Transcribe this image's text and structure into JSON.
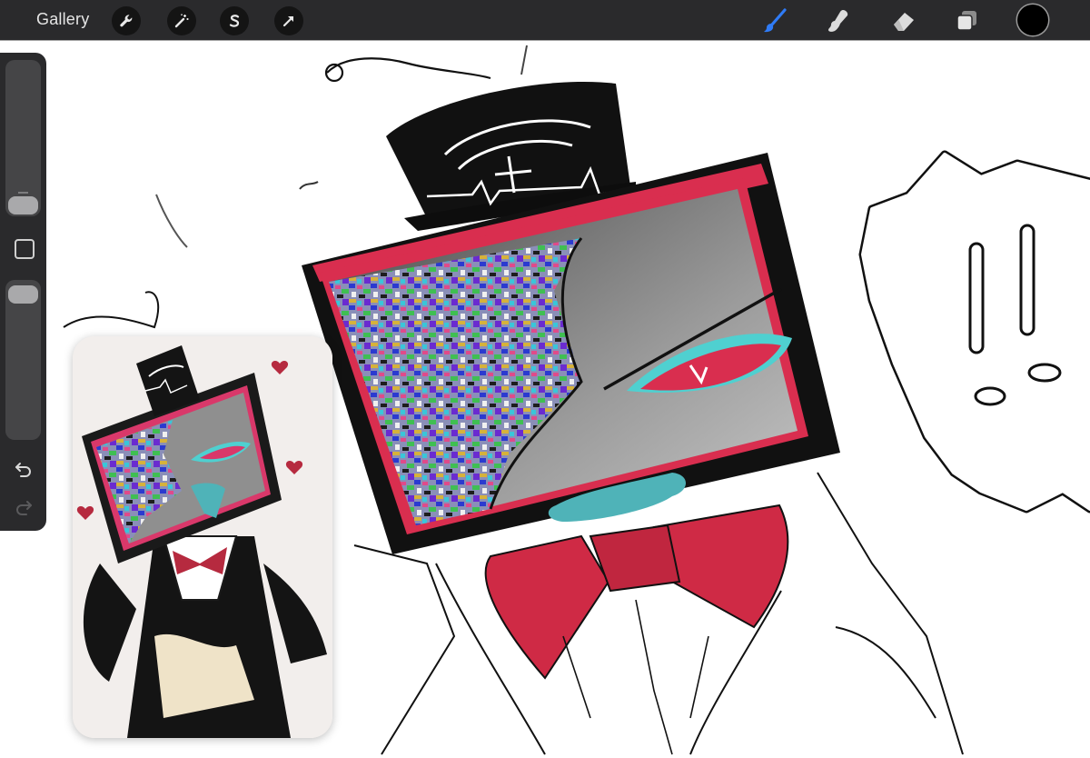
{
  "toolbar": {
    "gallery_label": "Gallery",
    "left_tools": [
      "wrench-icon",
      "magic-wand-icon",
      "selection-s-icon",
      "transform-arrow-icon"
    ],
    "right_tools": [
      "brush-icon",
      "smudge-icon",
      "eraser-icon",
      "layers-icon"
    ],
    "active_tool": "brush-icon",
    "active_color": "#000000",
    "accent": "#2f7bf6"
  },
  "sidebar": {
    "brush_size_level": 0.85,
    "opacity_level": 0.0,
    "modify_button": "square-icon",
    "undo": "undo-icon",
    "redo": "redo-icon"
  },
  "artwork": {
    "palette": {
      "frame": "#111111",
      "red": "#d92e4f",
      "screen": "#8a8a8a",
      "teal": "#4fb3b8",
      "bow": "#cf2a45"
    },
    "exclamation_bubble": "!!"
  },
  "reference": {
    "colors": {
      "bg": "#f2eeec",
      "frame": "#1a1a1a",
      "accent": "#d9386a",
      "bow": "#b62a3f",
      "ribbon": "#efe3c8"
    }
  }
}
